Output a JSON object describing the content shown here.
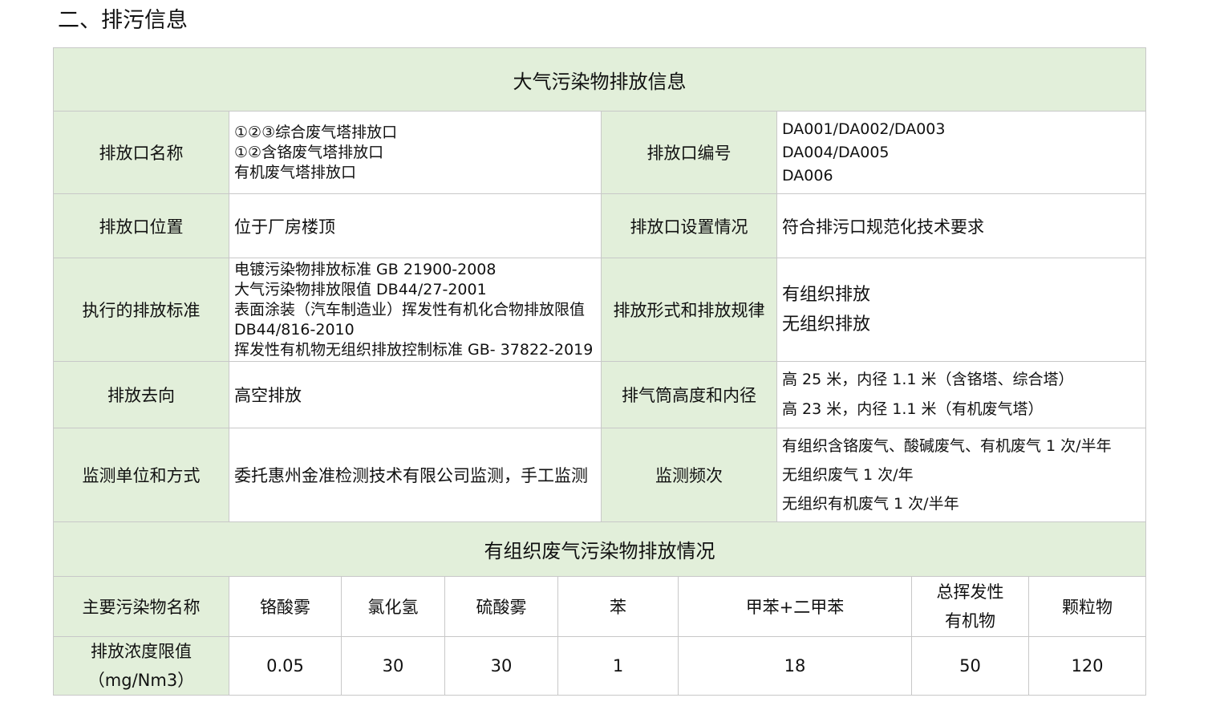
{
  "page_title": "二、排污信息",
  "table": {
    "title_air": "大气污染物排放信息",
    "rows": {
      "outlet_name": {
        "label": "排放口名称",
        "lines": [
          "①②③综合废气塔排放口",
          "①②含铬废气塔排放口",
          "有机废气塔排放口"
        ]
      },
      "outlet_no": {
        "label": "排放口编号",
        "lines": [
          "DA001/DA002/DA003",
          "DA004/DA005",
          "DA006"
        ]
      },
      "outlet_location": {
        "label": "排放口位置",
        "value": "位于厂房楼顶"
      },
      "outlet_setup": {
        "label": "排放口设置情况",
        "value": "符合排污口规范化技术要求"
      },
      "standard": {
        "label": "执行的排放标准",
        "lines": [
          "电镀污染物排放标准 GB 21900-2008",
          "大气污染物排放限值 DB44/27-2001",
          "表面涂装（汽车制造业）挥发性有机化合物排放限值",
          "DB44/816-2010",
          "挥发性有机物无组织排放控制标准 GB- 37822-2019"
        ]
      },
      "discharge_form": {
        "label": "排放形式和排放规律",
        "lines": [
          "有组织排放",
          "无组织排放"
        ]
      },
      "direction": {
        "label": "排放去向",
        "value": "高空排放"
      },
      "stack": {
        "label": "排气筒高度和内径",
        "lines": [
          "高 25 米，内径 1.1 米（含铬塔、综合塔）",
          "高 23 米，内径 1.1 米（有机废气塔）"
        ]
      },
      "monitor_unit": {
        "label": "监测单位和方式",
        "value": "委托惠州金准检测技术有限公司监测，手工监测"
      },
      "monitor_freq": {
        "label": "监测频次",
        "lines": [
          "有组织含铬废气、酸碱废气、有机废气 1 次/半年",
          "无组织废气 1 次/年",
          "无组织有机废气 1 次/半年"
        ]
      }
    },
    "title_organized": "有组织废气污染物排放情况",
    "pollutant_row_label": "主要污染物名称",
    "pollutants": [
      "铬酸雾",
      "氯化氢",
      "硫酸雾",
      "苯",
      "甲苯+二甲苯",
      "总挥发性\n有机物",
      "颗粒物"
    ],
    "limit_row_label_lines": [
      "排放浓度限值",
      "（mg/Nm3）"
    ],
    "limits": [
      "0.05",
      "30",
      "30",
      "1",
      "18",
      "50",
      "120"
    ],
    "colors": {
      "label_bg": "#e2efda",
      "border": "#c8c8c8"
    }
  }
}
